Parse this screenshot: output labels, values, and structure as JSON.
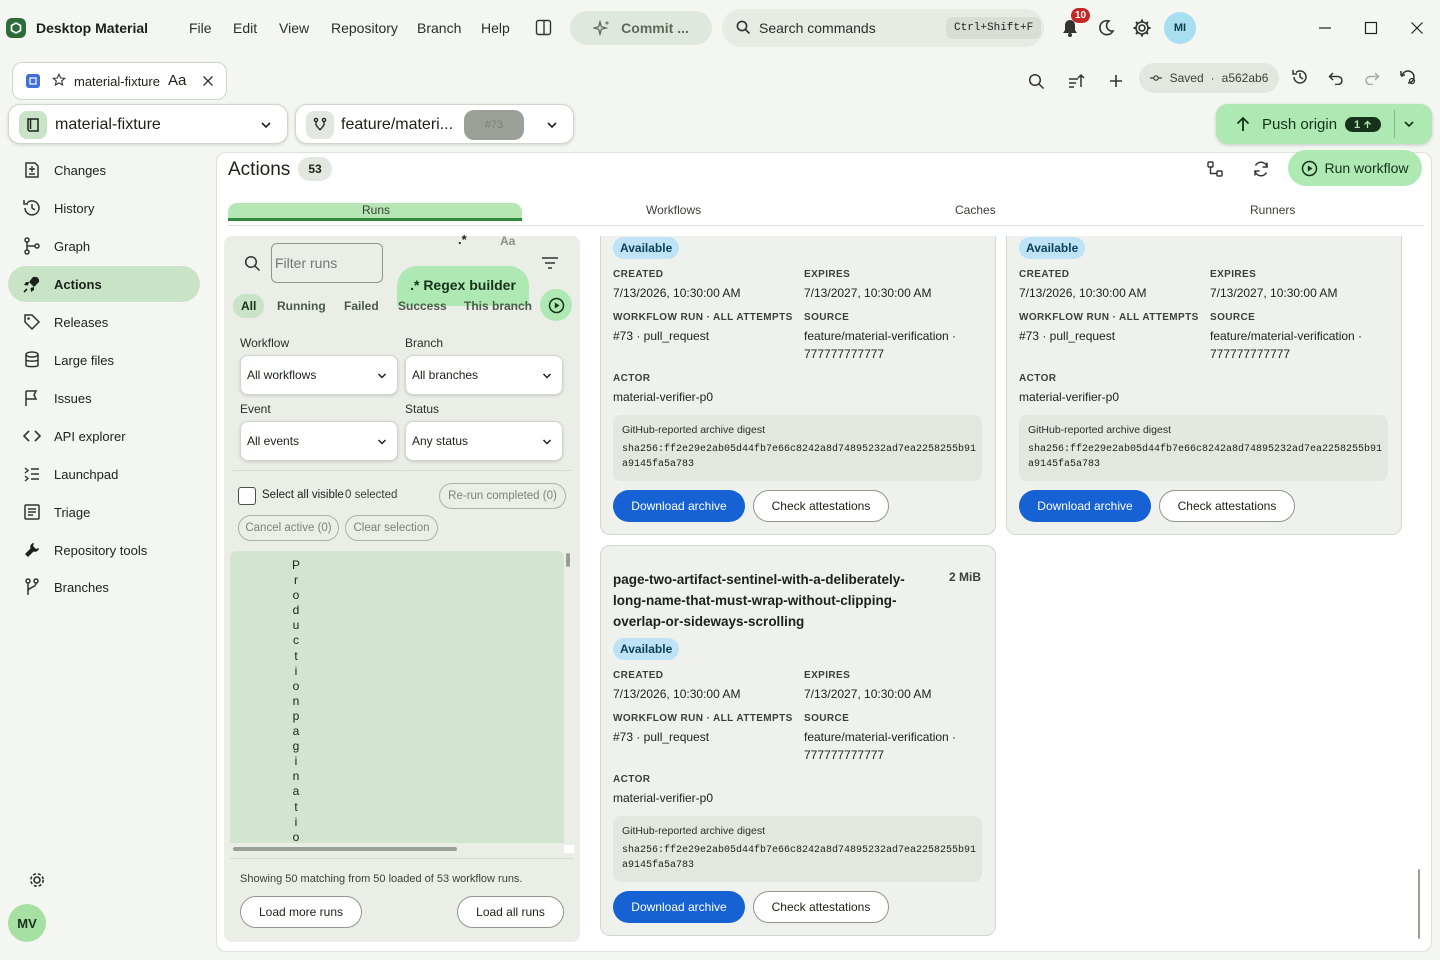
{
  "app": {
    "title": "Desktop Material",
    "menu": [
      "File",
      "Edit",
      "View",
      "Repository",
      "Branch",
      "Help"
    ],
    "commit_label": "Commit ...",
    "search_placeholder": "Search commands",
    "search_shortcut": "Ctrl+Shift+F",
    "notifications_count": "10",
    "user_initials": "MI"
  },
  "tab": {
    "name": "material-fixture",
    "font_label": "Aa"
  },
  "toolbar": {
    "saved_label": "Saved",
    "commit_sha": "a562ab6"
  },
  "repo": {
    "name": "material-fixture"
  },
  "branch": {
    "name": "feature/materi...",
    "pr": "#73"
  },
  "push": {
    "label": "Push origin",
    "count": "1"
  },
  "sidebar": {
    "items": [
      {
        "label": "Changes",
        "icon": "changes-icon"
      },
      {
        "label": "History",
        "icon": "history-icon"
      },
      {
        "label": "Graph",
        "icon": "graph-icon"
      },
      {
        "label": "Actions",
        "icon": "rocket-icon"
      },
      {
        "label": "Releases",
        "icon": "tag-icon"
      },
      {
        "label": "Large files",
        "icon": "database-icon"
      },
      {
        "label": "Issues",
        "icon": "flag-icon"
      },
      {
        "label": "API explorer",
        "icon": "code-icon"
      },
      {
        "label": "Launchpad",
        "icon": "launchpad-icon"
      },
      {
        "label": "Triage",
        "icon": "checklist-icon"
      },
      {
        "label": "Repository tools",
        "icon": "wrench-icon"
      },
      {
        "label": "Branches",
        "icon": "branch-icon"
      }
    ],
    "user_initials": "MV"
  },
  "actions": {
    "title": "Actions",
    "count": "53",
    "run_workflow": "Run workflow",
    "tabs": [
      "Runs",
      "Workflows",
      "Caches",
      "Runners"
    ]
  },
  "filters": {
    "filter_placeholder": "Filter runs",
    "regex_symbol": ".*",
    "case_symbol": "Aa",
    "regex_builder": ".* Regex builder",
    "chips": [
      "All",
      "Running",
      "Failed",
      "Success",
      "This branch"
    ],
    "workflow_label": "Workflow",
    "workflow_value": "All workflows",
    "branch_label": "Branch",
    "branch_value": "All branches",
    "event_label": "Event",
    "event_value": "All events",
    "status_label": "Status",
    "status_value": "Any status",
    "select_all": "Select all visible",
    "selected": "0 selected",
    "rerun": "Re-run completed (0)",
    "cancel": "Cancel active (0)",
    "clear": "Clear selection",
    "vertical_text": "Productionpaginatio",
    "showing": "Showing 50 matching from 50 loaded of 53 workflow runs.",
    "load_more": "Load more runs",
    "load_all": "Load all runs"
  },
  "artifact_labels": {
    "created": "CREATED",
    "expires": "EXPIRES",
    "workflow_run": "WORKFLOW RUN · ALL ATTEMPTS",
    "source": "SOURCE",
    "actor": "ACTOR",
    "digest": "GitHub-reported archive digest",
    "download": "Download archive",
    "check": "Check attestations"
  },
  "artifacts": [
    {
      "status": "Available",
      "created": "7/13/2026, 10:30:00 AM",
      "expires": "7/13/2027, 10:30:00 AM",
      "run": "#73 · pull_request",
      "source": "feature/material-verification ·",
      "source_sha": "777777777777",
      "actor": "material-verifier-p0",
      "digest_1": "sha256:ff2e29e2ab05d44fb7e66c8242a8d74895232ad7ea2258255b91",
      "digest_2": "a9145fa5a783"
    },
    {
      "status": "Available",
      "created": "7/13/2026, 10:30:00 AM",
      "expires": "7/13/2027, 10:30:00 AM",
      "run": "#73 · pull_request",
      "source": "feature/material-verification ·",
      "source_sha": "777777777777",
      "actor": "material-verifier-p0",
      "digest_1": "sha256:ff2e29e2ab05d44fb7e66c8242a8d74895232ad7ea2258255b91",
      "digest_2": "a9145fa5a783"
    },
    {
      "name": "page-two-artifact-sentinel-with-a-deliberately-long-name-that-must-wrap-without-clipping-overlap-or-sideways-scrolling",
      "size": "2 MiB",
      "status": "Available",
      "created": "7/13/2026, 10:30:00 AM",
      "expires": "7/13/2027, 10:30:00 AM",
      "run": "#73 · pull_request",
      "source": "feature/material-verification ·",
      "source_sha": "777777777777",
      "actor": "material-verifier-p0",
      "digest_1": "sha256:ff2e29e2ab05d44fb7e66c8242a8d74895232ad7ea2258255b91",
      "digest_2": "a9145fa5a783"
    }
  ],
  "colors": {
    "accent": "#2f8a3e",
    "primary_button": "#1662d4",
    "active_nav": "#c9e3c6",
    "available": "#bfe3f6"
  }
}
